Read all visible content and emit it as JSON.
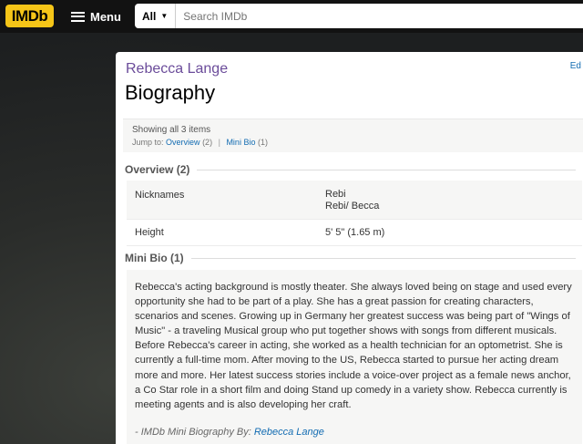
{
  "header": {
    "logo": "IMDb",
    "menu_label": "Menu",
    "search_category": "All",
    "search_placeholder": "Search IMDb"
  },
  "page": {
    "edit_link": "Ed",
    "person_name": "Rebecca Lange",
    "title": "Biography",
    "showing": "Showing all 3 items",
    "jump_label": "Jump to:",
    "jump_overview": "Overview",
    "jump_overview_count": "(2)",
    "jump_minibio": "Mini Bio",
    "jump_minibio_count": "(1)"
  },
  "overview": {
    "heading": "Overview (2)",
    "rows": [
      {
        "key": "Nicknames",
        "values": [
          "Rebi",
          "Rebi/ Becca"
        ]
      },
      {
        "key": "Height",
        "values": [
          "5' 5\" (1.65 m)"
        ]
      }
    ]
  },
  "minibio": {
    "heading": "Mini Bio (1)",
    "text": "Rebecca's acting background is mostly theater. She always loved being on stage and used every opportunity she had to be part of a play. She has a great passion for creating characters, scenarios and scenes. Growing up in Germany her greatest success was being part of \"Wings of Music\" - a traveling Musical group who put together shows with songs from different musicals. Before Rebecca's career in acting, she worked as a health technician for an optometrist. She is currently a full-time mom. After moving to the US, Rebecca started to pursue her acting dream more and more. Her latest success stories include a voice-over project as a female news anchor, a Co Star role in a short film and doing Stand up comedy in a variety show. Rebecca currently is meeting agents and is also developing her craft.",
    "byline_prefix": "- IMDb Mini Biography By:",
    "byline_author": "Rebecca Lange"
  },
  "colors": {
    "brand": "#f5c518",
    "link": "#136cb2",
    "name": "#6b4c9a"
  }
}
